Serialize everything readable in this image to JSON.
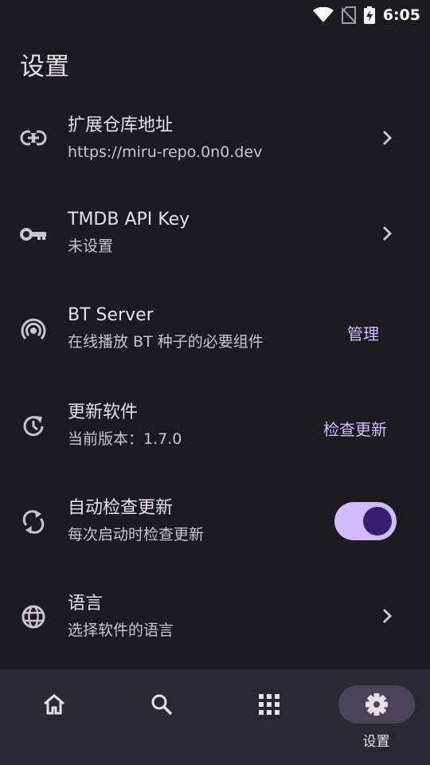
{
  "status_bar": {
    "time": "6:05"
  },
  "page_title": "设置",
  "settings": [
    {
      "icon": "link-icon",
      "title": "扩展仓库地址",
      "subtitle": "https://miru-repo.0n0.dev",
      "trailing": "chevron"
    },
    {
      "icon": "key-icon",
      "title": "TMDB API Key",
      "subtitle": "未设置",
      "trailing": "chevron"
    },
    {
      "icon": "broadcast-icon",
      "title": "BT Server",
      "subtitle": "在线播放 BT 种子的必要组件",
      "trailing": "action",
      "action_label": "管理"
    },
    {
      "icon": "update-icon",
      "title": "更新软件",
      "subtitle": "当前版本：1.7.0",
      "trailing": "action",
      "action_label": "检查更新"
    },
    {
      "icon": "sync-icon",
      "title": "自动检查更新",
      "subtitle": "每次启动时检查更新",
      "trailing": "switch",
      "switch_on": true
    },
    {
      "icon": "globe-icon",
      "title": "语言",
      "subtitle": "选择软件的语言",
      "trailing": "chevron"
    }
  ],
  "bottom_nav": {
    "items": [
      {
        "icon": "home-icon",
        "label": "",
        "active": false
      },
      {
        "icon": "search-icon",
        "label": "",
        "active": false
      },
      {
        "icon": "grid-icon",
        "label": "",
        "active": false
      },
      {
        "icon": "gear-icon",
        "label": "设置",
        "active": true
      }
    ]
  },
  "colors": {
    "background": "#1c1b1f",
    "accent": "#d0bcff",
    "switch_thumb": "#381e72",
    "nav_background": "#2b2930",
    "nav_active_pill": "#4a4458"
  }
}
